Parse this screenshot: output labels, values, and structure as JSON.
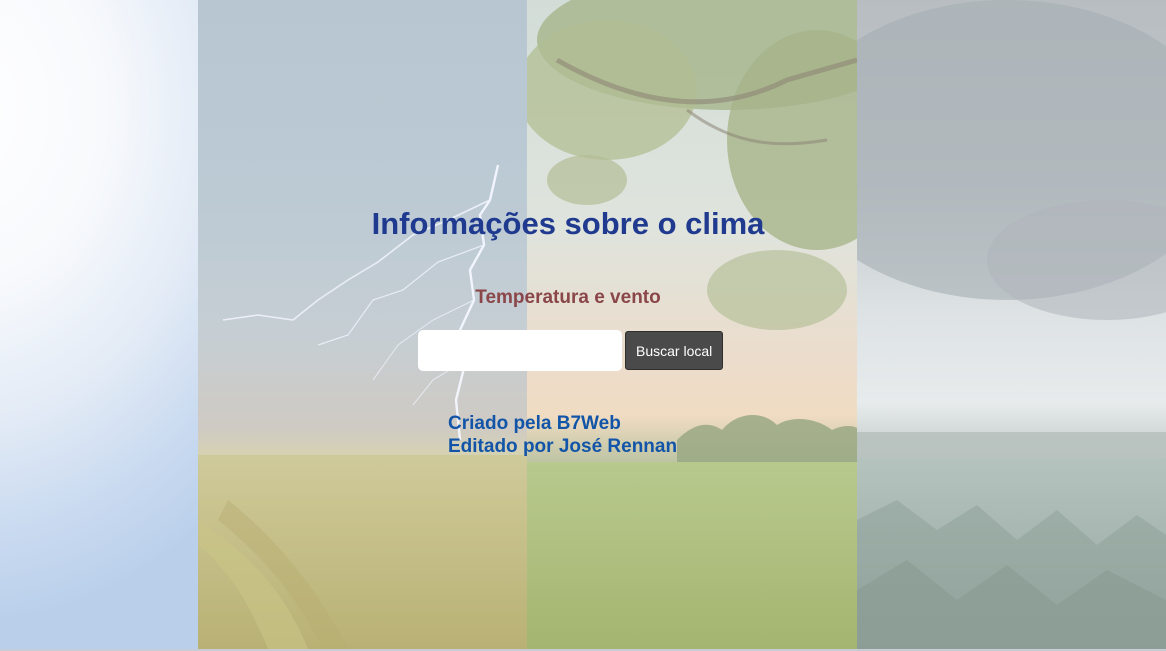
{
  "header": {
    "title": "Informações sobre o clima",
    "subtitle": "Temperatura e vento"
  },
  "search": {
    "placeholder": "",
    "value": "",
    "button_label": "Buscar local"
  },
  "credits": {
    "created_by": "Criado pela B7Web",
    "edited_by": "Editado por José Rennan"
  },
  "colors": {
    "title": "#1f3a8f",
    "subtitle": "#8a4648",
    "credits": "#1255a8",
    "button_bg": "#4a4a4a",
    "button_text": "#ffffff"
  },
  "background": {
    "panels": [
      "sunny-sky",
      "thunderstorm-field",
      "spring-tree-field",
      "rainy-cornfield"
    ]
  }
}
